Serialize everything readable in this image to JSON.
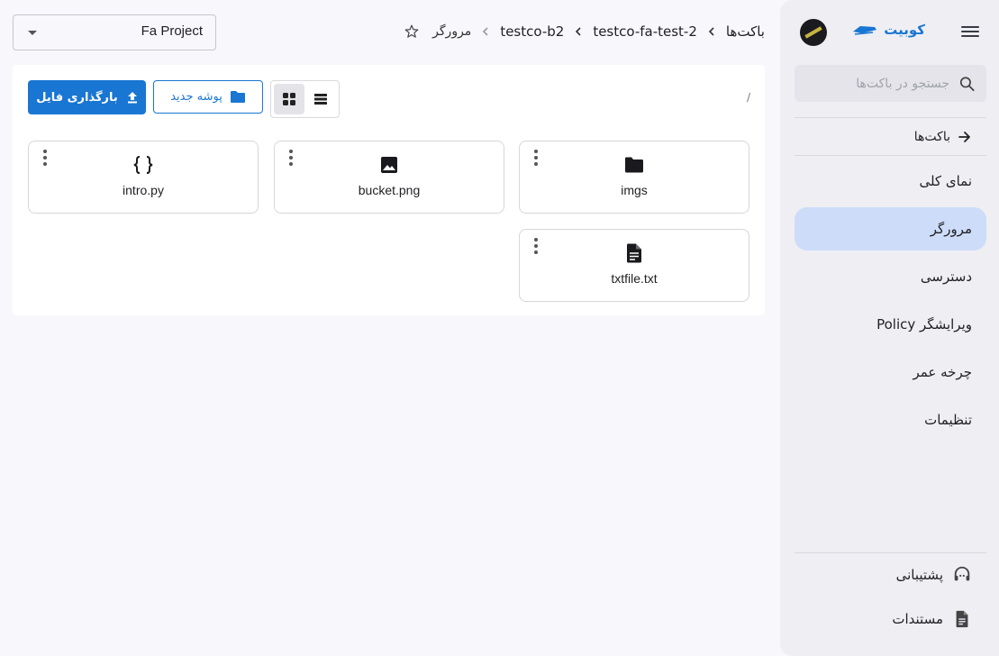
{
  "sidebar": {
    "brand": "کوبیت",
    "search_placeholder": "جستجو در باکت‌ها",
    "back_label": "باکت‌ها",
    "items": [
      {
        "label": "نمای کلی"
      },
      {
        "label": "مرورگر",
        "active": true
      },
      {
        "label": "دسترسی"
      },
      {
        "label": "ویرایشگر Policy"
      },
      {
        "label": "چرخه عمر"
      },
      {
        "label": "تنظیمات"
      }
    ],
    "bottom": [
      {
        "label": "پشتیبانی",
        "icon": "headset-icon"
      },
      {
        "label": "مستندات",
        "icon": "document-icon"
      }
    ]
  },
  "header": {
    "project": "Fa Project",
    "breadcrumb": [
      "باکت‌ها",
      "testco-fa-test-2",
      "testco-b2",
      "مرورگر"
    ]
  },
  "toolbar": {
    "path": "/",
    "new_folder_label": "پوشه جدید",
    "upload_label": "بارگذاری فایل",
    "view_mode": "grid"
  },
  "files": [
    {
      "name": "imgs",
      "type": "folder",
      "icon": "folder-icon"
    },
    {
      "name": "bucket.png",
      "type": "image",
      "icon": "image-icon"
    },
    {
      "name": "intro.py",
      "type": "code",
      "icon": "code-braces-icon"
    },
    {
      "name": "txtfile.txt",
      "type": "text",
      "icon": "text-file-icon"
    }
  ],
  "colors": {
    "accent": "#1976d2",
    "active_nav": "#cddcf8",
    "sidebar_bg": "#eeeef3",
    "page_bg": "#f7f7fc"
  }
}
